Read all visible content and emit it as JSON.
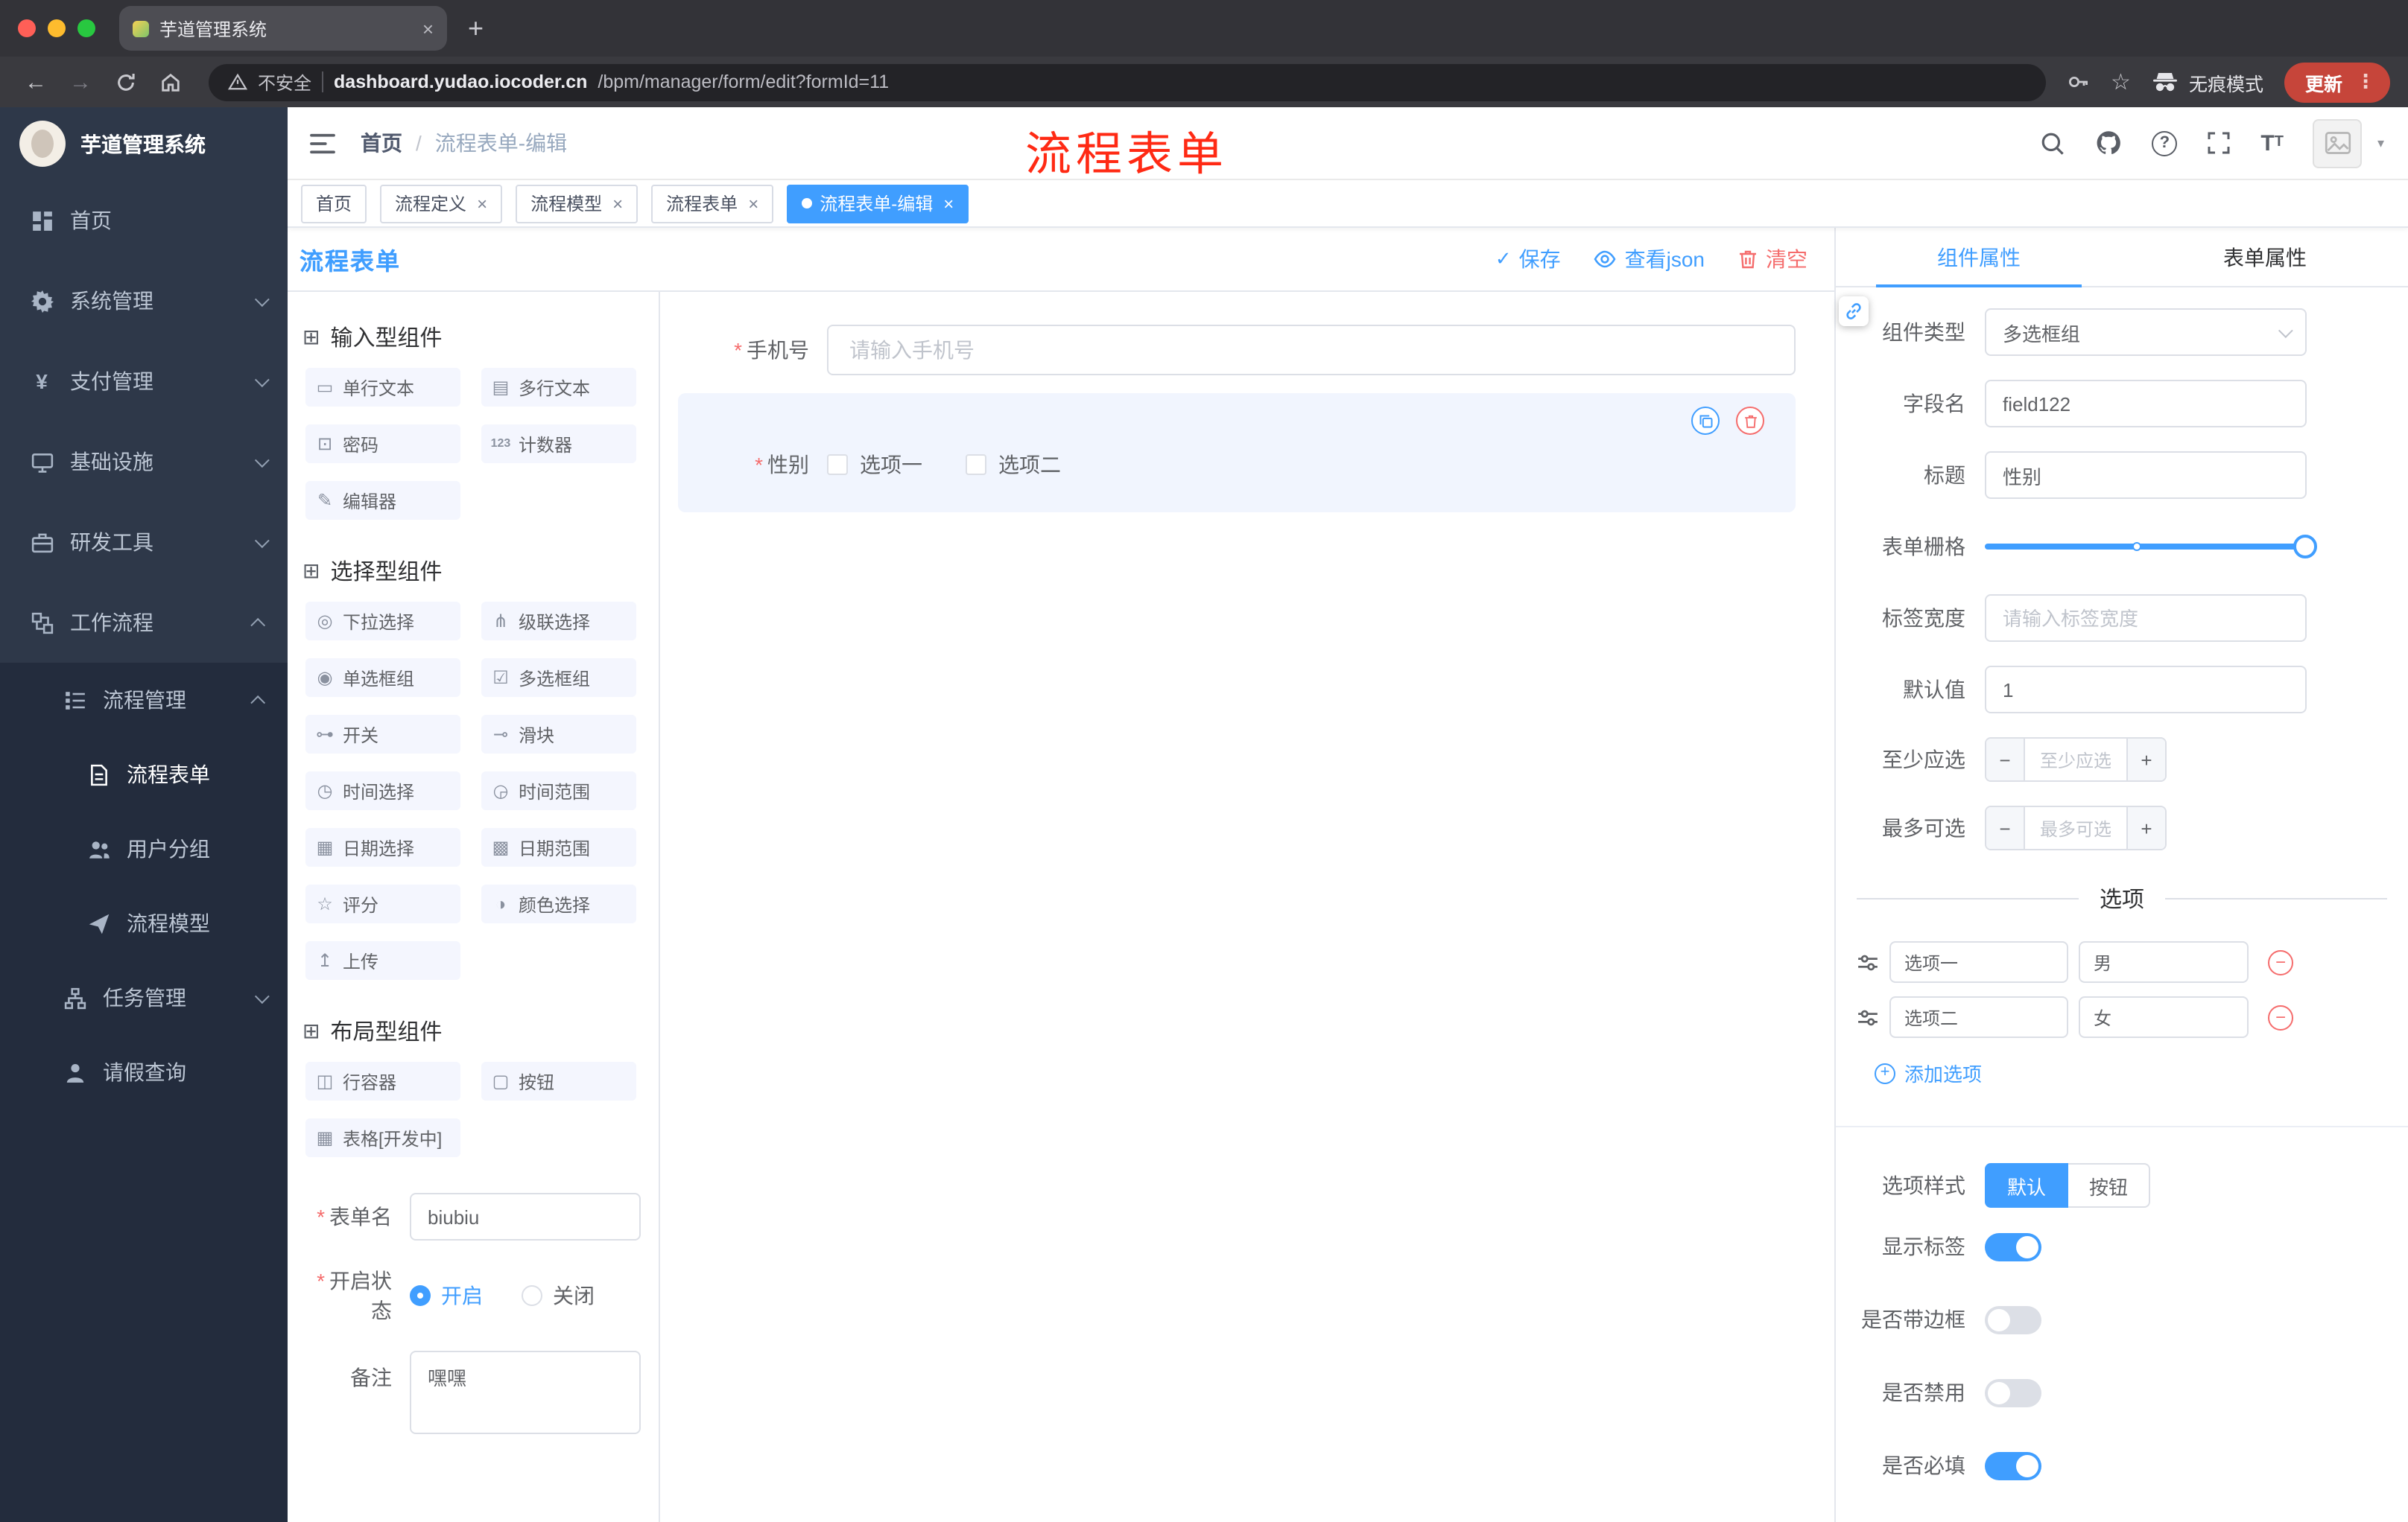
{
  "colors": {
    "accent": "#409eff",
    "danger": "#f56c6c",
    "annotation_red": "#ff2a14",
    "sidebar_bg": "#2e3849",
    "sidebar_sub_bg": "#232c3d"
  },
  "browser": {
    "tab_title": "芋道管理系统",
    "security": "不安全",
    "url_host": "dashboard.yudao.iocoder.cn",
    "url_path": "/bpm/manager/form/edit?formId=11",
    "incognito": "无痕模式",
    "update": "更新"
  },
  "annotation": {
    "text": "流程表单"
  },
  "sidebar": {
    "title": "芋道管理系统",
    "items": [
      {
        "label": "首页",
        "icon": "dashboard"
      },
      {
        "label": "系统管理",
        "icon": "gear"
      },
      {
        "label": "支付管理",
        "icon": "yen"
      },
      {
        "label": "基础设施",
        "icon": "monitor"
      },
      {
        "label": "研发工具",
        "icon": "toolbox"
      },
      {
        "label": "工作流程",
        "icon": "workflow"
      }
    ],
    "sub": [
      {
        "label": "流程管理",
        "icon": "list"
      },
      {
        "label": "流程表单",
        "icon": "document"
      },
      {
        "label": "用户分组",
        "icon": "users"
      },
      {
        "label": "流程模型",
        "icon": "send"
      },
      {
        "label": "任务管理",
        "icon": "tree"
      },
      {
        "label": "请假查询",
        "icon": "person"
      }
    ]
  },
  "header": {
    "breadcrumb1": "首页",
    "breadcrumb2": "流程表单-编辑"
  },
  "tags": [
    "首页",
    "流程定义",
    "流程模型",
    "流程表单",
    "流程表单-编辑"
  ],
  "designer": {
    "title": "流程表单",
    "save": "保存",
    "view_json": "查看json",
    "clear": "清空"
  },
  "palette": {
    "section1": "输入型组件",
    "section2": "选择型组件",
    "section3": "布局型组件",
    "s1": [
      {
        "label": "单行文本",
        "icon": "text-input"
      },
      {
        "label": "多行文本",
        "icon": "textarea"
      },
      {
        "label": "密码",
        "icon": "password"
      },
      {
        "label": "计数器",
        "icon": "counter"
      },
      {
        "label": "编辑器",
        "icon": "editor"
      }
    ],
    "s2": [
      {
        "label": "下拉选择",
        "icon": "select"
      },
      {
        "label": "级联选择",
        "icon": "cascader"
      },
      {
        "label": "单选框组",
        "icon": "radio-group"
      },
      {
        "label": "多选框组",
        "icon": "checkbox-group"
      },
      {
        "label": "开关",
        "icon": "switch"
      },
      {
        "label": "滑块",
        "icon": "slider"
      },
      {
        "label": "时间选择",
        "icon": "time-picker"
      },
      {
        "label": "时间范围",
        "icon": "time-range"
      },
      {
        "label": "日期选择",
        "icon": "date-picker"
      },
      {
        "label": "日期范围",
        "icon": "date-range"
      },
      {
        "label": "评分",
        "icon": "rate"
      },
      {
        "label": "颜色选择",
        "icon": "color-picker"
      },
      {
        "label": "上传",
        "icon": "upload"
      }
    ],
    "s3": [
      {
        "label": "行容器",
        "icon": "row-container"
      },
      {
        "label": "按钮",
        "icon": "button"
      },
      {
        "label": "表格[开发中]",
        "icon": "table"
      }
    ]
  },
  "meta": {
    "form_name_label": "表单名",
    "form_name_value": "biubiu",
    "status_label": "开启状态",
    "status_on": "开启",
    "status_off": "关闭",
    "remark_label": "备注",
    "remark_value": "嘿嘿"
  },
  "canvas": {
    "phone_label": "手机号",
    "phone_placeholder": "请输入手机号",
    "gender_label": "性别",
    "gender_opt1": "选项一",
    "gender_opt2": "选项二"
  },
  "props": {
    "tab1": "组件属性",
    "tab2": "表单属性",
    "type_label": "组件类型",
    "type_value": "多选框组",
    "field_label": "字段名",
    "field_value": "field122",
    "title_label": "标题",
    "title_value": "性别",
    "grid_label": "表单栅格",
    "width_label": "标签宽度",
    "width_placeholder": "请输入标签宽度",
    "default_label": "默认值",
    "default_value": "1",
    "min_label": "至少应选",
    "min_placeholder": "至少应选",
    "max_label": "最多可选",
    "max_placeholder": "最多可选",
    "options_title": "选项",
    "opt1_label": "选项一",
    "opt1_value": "男",
    "opt2_label": "选项二",
    "opt2_value": "女",
    "add_option": "添加选项",
    "style_label": "选项样式",
    "style_default": "默认",
    "style_button": "按钮",
    "toggle_show_label": "显示标签",
    "toggle_border": "是否带边框",
    "toggle_disabled": "是否禁用",
    "toggle_required": "是否必填"
  }
}
